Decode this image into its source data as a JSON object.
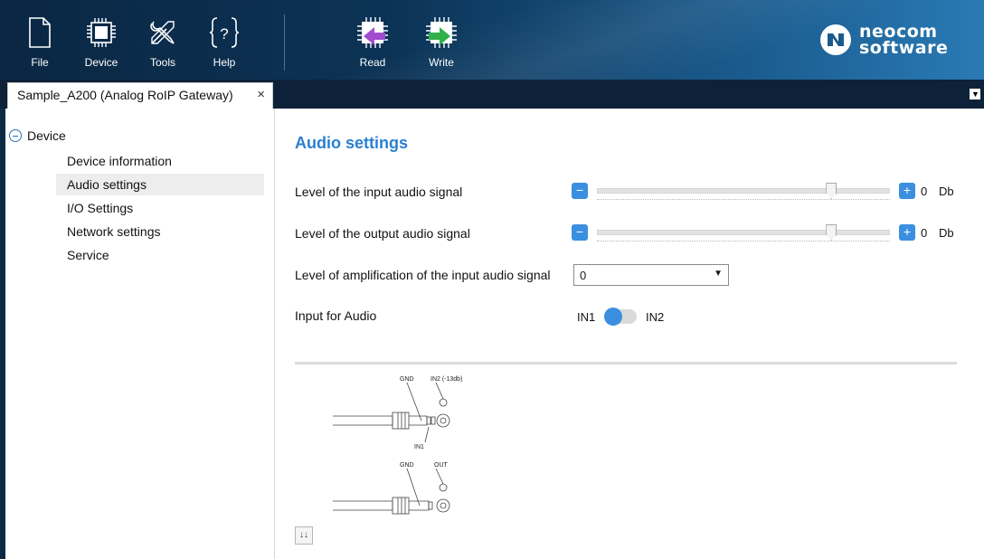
{
  "toolbar": {
    "buttons": [
      {
        "label": "File",
        "icon": "file-icon"
      },
      {
        "label": "Device",
        "icon": "chip-icon"
      },
      {
        "label": "Tools",
        "icon": "tools-icon"
      },
      {
        "label": "Help",
        "icon": "help-icon"
      },
      {
        "label": "Read",
        "icon": "read-icon"
      },
      {
        "label": "Write",
        "icon": "write-icon"
      }
    ],
    "logo": {
      "line1": "neocom",
      "line2": "software"
    }
  },
  "tab": {
    "title": "Sample_A200 (Analog RoIP Gateway)",
    "close": "×"
  },
  "tab_menu_glyph": "▼",
  "sidebar": {
    "root": "Device",
    "items": [
      {
        "label": "Device information",
        "selected": false
      },
      {
        "label": "Audio settings",
        "selected": true
      },
      {
        "label": "I/O Settings",
        "selected": false
      },
      {
        "label": "Network settings",
        "selected": false
      },
      {
        "label": "Service",
        "selected": false
      }
    ]
  },
  "content": {
    "title": "Audio settings",
    "input_level": {
      "label": "Level of the input audio signal",
      "minus": "−",
      "plus": "+",
      "value": "0",
      "unit": "Db",
      "position": 0.8
    },
    "output_level": {
      "label": "Level of the output audio signal",
      "minus": "−",
      "plus": "+",
      "value": "0",
      "unit": "Db",
      "position": 0.8
    },
    "amplification": {
      "label": "Level of amplification of the input audio signal",
      "value": "0",
      "arrow": "▼"
    },
    "input_for_audio": {
      "label": "Input for Audio",
      "left": "IN1",
      "right": "IN2",
      "selected": "IN1"
    },
    "diagram": {
      "top": {
        "gnd": "GND",
        "in2": "IN2 (-13db)",
        "in1": "IN1"
      },
      "bottom": {
        "gnd": "GND",
        "out": "OUT"
      }
    },
    "expand_glyph": "↓↓"
  },
  "colors": {
    "accent": "#2a7fd1",
    "button": "#3b8fe0",
    "toolbar": "#0c3356"
  }
}
